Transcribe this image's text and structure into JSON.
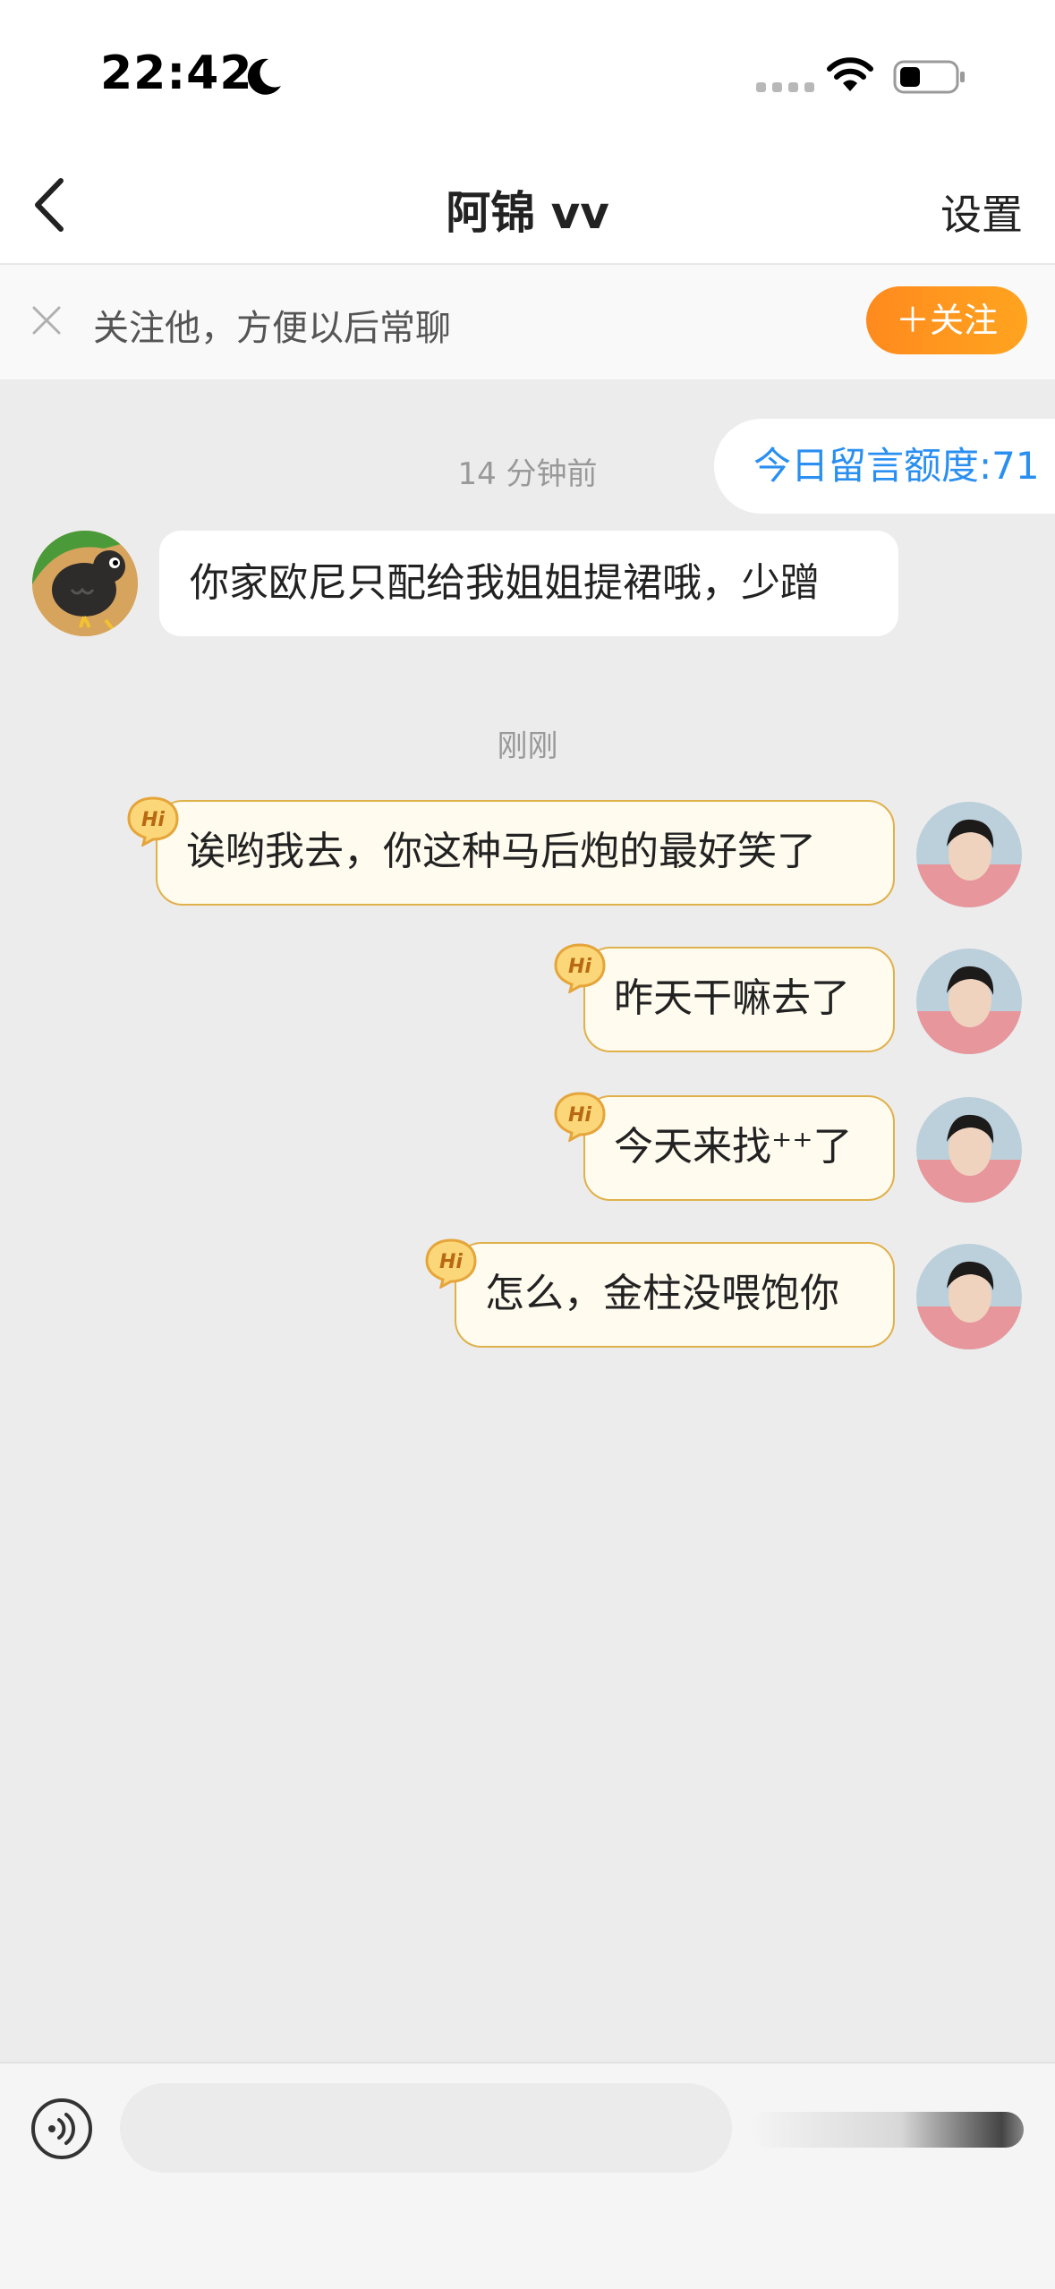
{
  "status_bar": {
    "time": "22:42"
  },
  "header": {
    "title": "阿锦 vv",
    "settings_label": "设置"
  },
  "follow_banner": {
    "text": "关注他，方便以后常聊",
    "button_label": "＋关注"
  },
  "quota": {
    "text": "今日留言额度:71"
  },
  "messages": [
    {
      "timestamp": "14 分钟前"
    },
    {
      "side": "left",
      "text": "你家欧尼只配给我姐姐提裙哦，少蹭"
    },
    {
      "timestamp": "刚刚"
    },
    {
      "side": "right",
      "text": "诶哟我去，你这种马后炮的最好笑了"
    },
    {
      "side": "right",
      "text": "昨天干嘛去了"
    },
    {
      "side": "right",
      "text": "今天来找⁺⁺了"
    },
    {
      "side": "right",
      "text": "怎么，金柱没喂饱你"
    }
  ],
  "badge_text": "Hi",
  "colors": {
    "accent_orange": "#ff951f",
    "quota_blue": "#2a8ff0",
    "bubble_border": "#e0b14b",
    "background": "#ececec"
  },
  "input": {
    "value": "",
    "placeholder": ""
  }
}
